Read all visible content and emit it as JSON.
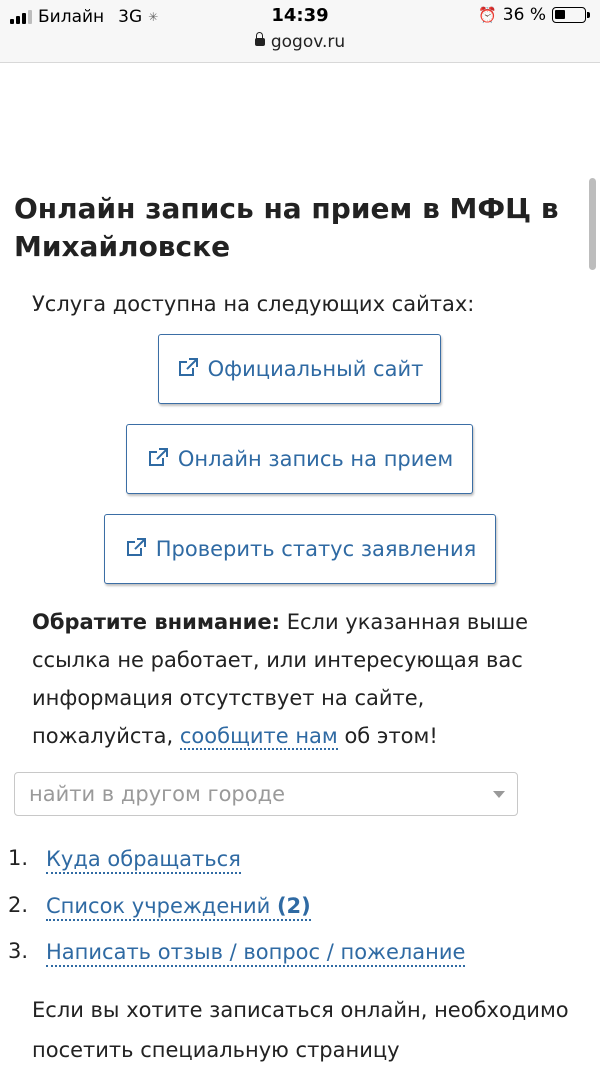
{
  "status_bar": {
    "carrier": "Билайн",
    "network": "3G",
    "time": "14:39",
    "battery_label": "36 %",
    "battery_fill_fraction": 0.36,
    "url": "gogov.ru"
  },
  "page": {
    "title": "Онлайн запись на прием в МФЦ в Михайловске",
    "intro": "Услуга доступна на следующих сайтах:"
  },
  "buttons": [
    {
      "label": "Официальный сайт",
      "icon": "external-link-icon"
    },
    {
      "label": "Онлайн запись на прием",
      "icon": "external-link-icon"
    },
    {
      "label": "Проверить статус заявления",
      "icon": "external-link-icon"
    }
  ],
  "notice": {
    "bold_prefix": "Обратите внимание:",
    "text_before_link": " Если указанная выше ссылка не работает, или интересующая вас информация отсутствует на сайте, пожалуйста, ",
    "link_label": "сообщите нам",
    "text_after_link": " об этом!"
  },
  "city_select": {
    "placeholder": "найти в другом городе"
  },
  "nav_list": [
    {
      "num": "1.",
      "label": "Куда обращаться",
      "count": ""
    },
    {
      "num": "2.",
      "label": "Список учреждений",
      "count": "(2)"
    },
    {
      "num": "3.",
      "label": "Написать отзыв / вопрос / пожелание",
      "count": ""
    }
  ],
  "footer_text": "Если вы хотите записаться онлайн, необходимо посетить специальную страницу",
  "colors": {
    "link": "#2f6aa3",
    "button_border": "#3b6ea5",
    "text": "#222222"
  }
}
